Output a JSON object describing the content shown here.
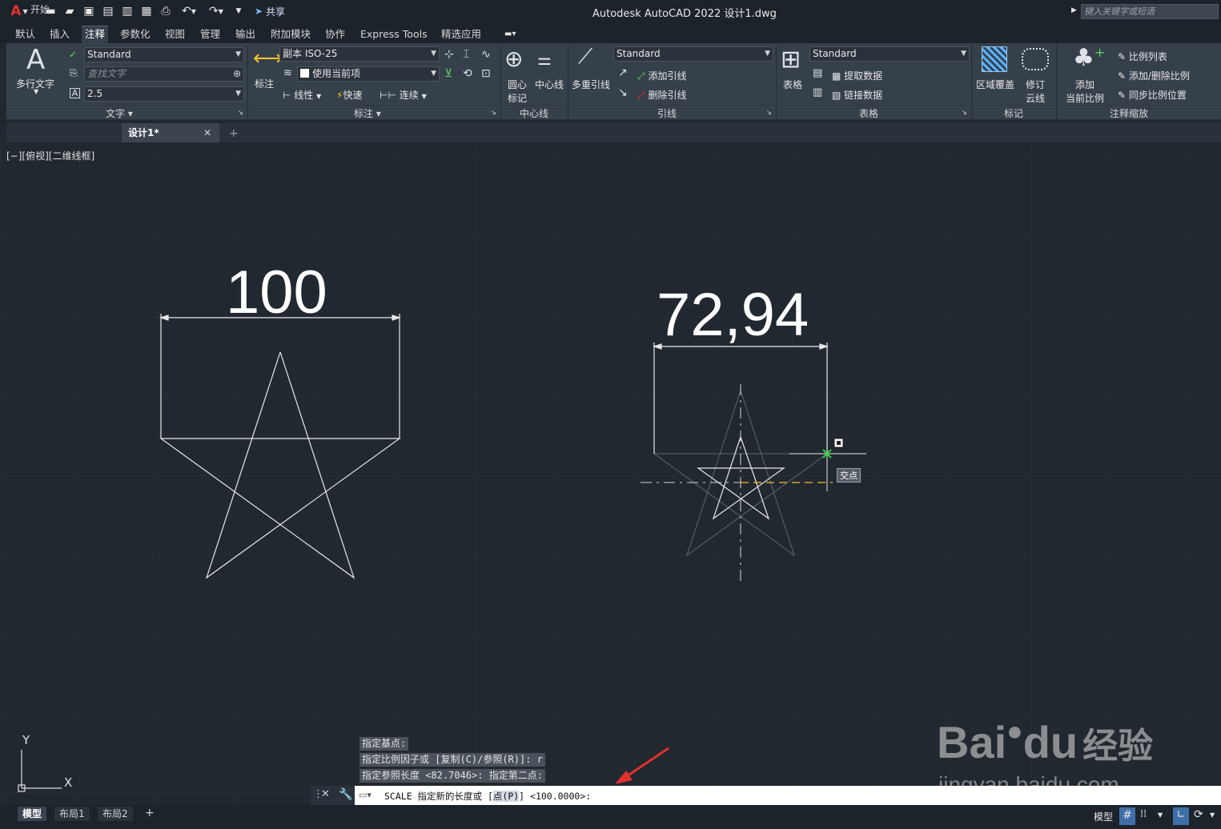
{
  "app": {
    "title": "Autodesk AutoCAD 2022    设计1.dwg",
    "logo": "A",
    "share_label": "共享",
    "search_placeholder": "键入关键字或短语"
  },
  "menu_tabs": [
    "默认",
    "插入",
    "注释",
    "参数化",
    "视图",
    "管理",
    "输出",
    "附加模块",
    "协作",
    "Express Tools",
    "精选应用"
  ],
  "active_tab": "注释",
  "ribbon": {
    "text_panel": {
      "mtext_label": "多行文字",
      "text_style": "Standard",
      "find_text_placeholder": "查找文字",
      "text_height": "2.5",
      "title": "文字"
    },
    "dim_panel": {
      "dim_label": "标注",
      "dim_style": "副本 ISO-25",
      "layer": "使用当前项",
      "linear": "线性",
      "quick": "快速",
      "continuous": "连续",
      "title": "标注"
    },
    "centerline_panel": {
      "center_mark": "圆心标记",
      "center_mark_l1": "圆心",
      "center_mark_l2": "标记",
      "centerline": "中心线",
      "title": "中心线"
    },
    "leader_panel": {
      "multileader": "多重引线",
      "style": "Standard",
      "add_leader": "添加引线",
      "remove_leader": "删除引线",
      "title": "引线"
    },
    "table_panel": {
      "table": "表格",
      "style": "Standard",
      "extract": "提取数据",
      "link": "链接数据",
      "title": "表格"
    },
    "markup_panel": {
      "wipeout": "区域覆盖",
      "revcloud_l1": "修订",
      "revcloud_l2": "云线",
      "title": "标记"
    },
    "scale_panel": {
      "add_l1": "添加",
      "add_l2": "当前比例",
      "scale_list": "比例列表",
      "add_delete": "添加/删除比例",
      "sync": "同步比例位置",
      "title": "注释缩放"
    }
  },
  "doc_tabs": [
    "开始",
    "设计1*"
  ],
  "active_doc": "设计1*",
  "viewport_label": "[−][俯视][二维线框]",
  "drawing": {
    "left_dim": "100",
    "right_dim": "72,94",
    "snap_tooltip": "交点",
    "ucs_x": "X",
    "ucs_y": "Y"
  },
  "command": {
    "history": [
      "指定基点:",
      "指定比例因子或 [复制(C)/参照(R)]: r",
      "指定参照长度 <82.7046>:  指定第二点:"
    ],
    "prompt_prefix": "SCALE 指定新的长度或 [",
    "prompt_option": "点(P)",
    "prompt_suffix": "] <100.0000>:"
  },
  "layout_tabs": [
    "模型",
    "布局1",
    "布局2"
  ],
  "active_layout": "模型",
  "status": {
    "model_label": "模型"
  },
  "watermark": {
    "brand": "Bai",
    "brand2": "du",
    "suffix": "经验",
    "url": "jingyan.baidu.com"
  },
  "colors": {
    "accent_red": "#e0312e",
    "snap_green": "#29d63a",
    "guide_yellow": "#f2c12e",
    "canvas_bg": "#212830"
  }
}
